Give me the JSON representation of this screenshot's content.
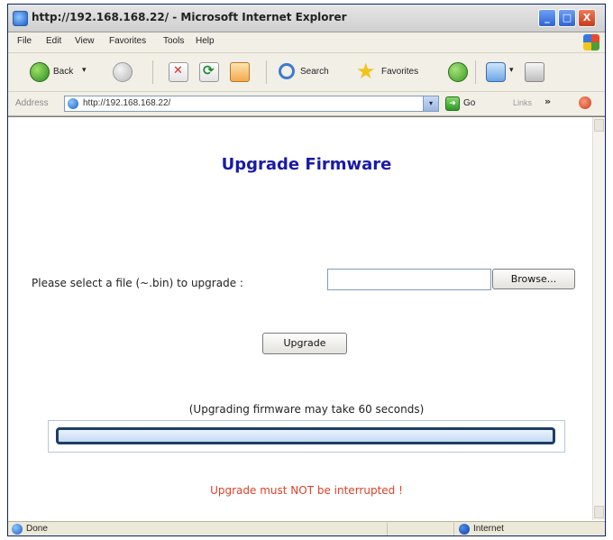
{
  "window": {
    "title": "http://192.168.168.22/ - Microsoft Internet Explorer",
    "minimize_glyph": "_",
    "maximize_glyph": "□",
    "close_glyph": "X"
  },
  "menu": {
    "file": "File",
    "edit": "Edit",
    "view": "View",
    "favorites": "Favorites",
    "tools": "Tools",
    "help": "Help"
  },
  "toolbar": {
    "back_label": "Back",
    "search_label": "Search",
    "favorites_label": "Favorites",
    "dropdown_glyph": "▾"
  },
  "address": {
    "label": "Address",
    "url": "http://192.168.168.22/",
    "go_label": "Go",
    "links_label": "Links",
    "chevron": "»"
  },
  "page": {
    "title": "Upgrade Firmware",
    "file_prompt": "Please select a file (~.bin) to upgrade :",
    "file_value": "",
    "browse_label": "Browse...",
    "upgrade_label": "Upgrade",
    "note": "(Upgrading firmware may take 60 seconds)",
    "progress_percent": 0,
    "warning": "Upgrade must NOT be interrupted !"
  },
  "status": {
    "text": "Done",
    "zone": "Internet"
  },
  "colors": {
    "title_blue": "#1a1aa8",
    "warning_red": "#e0402a",
    "progress_border": "#1d3d66"
  }
}
